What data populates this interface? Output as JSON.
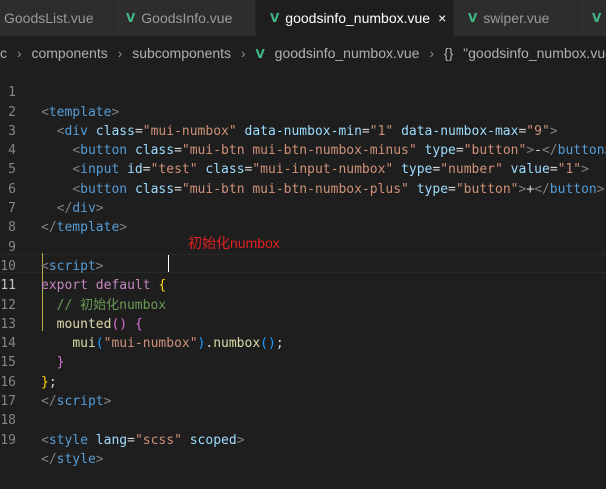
{
  "tabs": [
    {
      "label": "GoodsList.vue",
      "icon": "vue-file-icon",
      "active": false
    },
    {
      "label": "GoodsInfo.vue",
      "icon": "vue-file-icon",
      "active": false
    },
    {
      "label": "goodsinfo_numbox.vue",
      "icon": "vue-file-icon",
      "active": true,
      "close": "×"
    },
    {
      "label": "swiper.vue",
      "icon": "vue-file-icon",
      "active": false
    }
  ],
  "breadcrumb": {
    "items": [
      "c",
      "components",
      "subcomponents",
      "goodsinfo_numbox.vue",
      "{}",
      "\"goodsinfo_numbox.vue\""
    ],
    "separator": "›"
  },
  "annotation": "初始化numbox",
  "line_numbers": [
    "1",
    "2",
    "3",
    "4",
    "5",
    "6",
    "7",
    "8",
    "9",
    "10",
    "11",
    "12",
    "13",
    "14",
    "15",
    "16",
    "17",
    "18",
    "19"
  ],
  "code": {
    "l1": {
      "open": "<",
      "tag": "template",
      "close": ">"
    },
    "l2": {
      "open": "<",
      "tag": "div",
      "a1": "class",
      "eq": "=",
      "v1": "\"mui-numbox\"",
      "a2": "data-numbox-min",
      "v2": "\"1\"",
      "a3": "data-numbox-max",
      "v3": "\"9\"",
      "close": ">"
    },
    "l3": {
      "open": "<",
      "tag": "button",
      "a1": "class",
      "v1": "\"mui-btn mui-btn-numbox-minus\"",
      "a2": "type",
      "v2": "\"button\"",
      "close": ">",
      "text": "-",
      "end_open": "</",
      "end_tag": "button",
      "end_close": ">"
    },
    "l4": {
      "open": "<",
      "tag": "input",
      "a1": "id",
      "v1": "\"test\"",
      "a2": "class",
      "v2": "\"mui-input-numbox\"",
      "a3": "type",
      "v3": "\"number\"",
      "a4": "value",
      "v4": "\"1\"",
      "close": ">"
    },
    "l5": {
      "open": "<",
      "tag": "button",
      "a1": "class",
      "v1": "\"mui-btn mui-btn-numbox-plus\"",
      "a2": "type",
      "v2": "\"button\"",
      "close": ">",
      "text": "+",
      "end_open": "</",
      "end_tag": "button",
      "end_close": ">"
    },
    "l6": {
      "end_open": "</",
      "tag": "div",
      "close": ">"
    },
    "l7": {
      "end_open": "</",
      "tag": "template",
      "close": ">"
    },
    "l9": {
      "open": "<",
      "tag": "script",
      "close": ">"
    },
    "l10": {
      "kw1": "export",
      "kw2": "default",
      "brace": "{"
    },
    "l11": {
      "comment": "// 初始化numbox"
    },
    "l12": {
      "fn": "mounted",
      "parens": "()",
      "brace": "{"
    },
    "l13": {
      "fn": "mui",
      "lp": "(",
      "str": "\"mui-numbox\"",
      "rp": ")",
      "dot": ".",
      "method": "numbox",
      "call": "()",
      "semi": ";"
    },
    "l14": {
      "brace": "}"
    },
    "l15": {
      "brace": "}",
      "semi": ";"
    },
    "l16": {
      "end_open": "</",
      "tag": "script",
      "close": ">"
    },
    "l18": {
      "open": "<",
      "tag": "style",
      "a1": "lang",
      "v1": "\"scss\"",
      "a2": "scoped",
      "close": ">"
    },
    "l19": {
      "end_open": "</",
      "tag": "style",
      "close": ">"
    }
  },
  "colors": {
    "background": "#1e1e1e",
    "tag": "#569cd6",
    "attribute": "#9cdcfe",
    "string": "#ce9178",
    "keyword": "#c586c0",
    "function": "#dcdcaa",
    "comment": "#6a9955",
    "annotation": "#e02020",
    "vue_icon": "#41b883"
  }
}
